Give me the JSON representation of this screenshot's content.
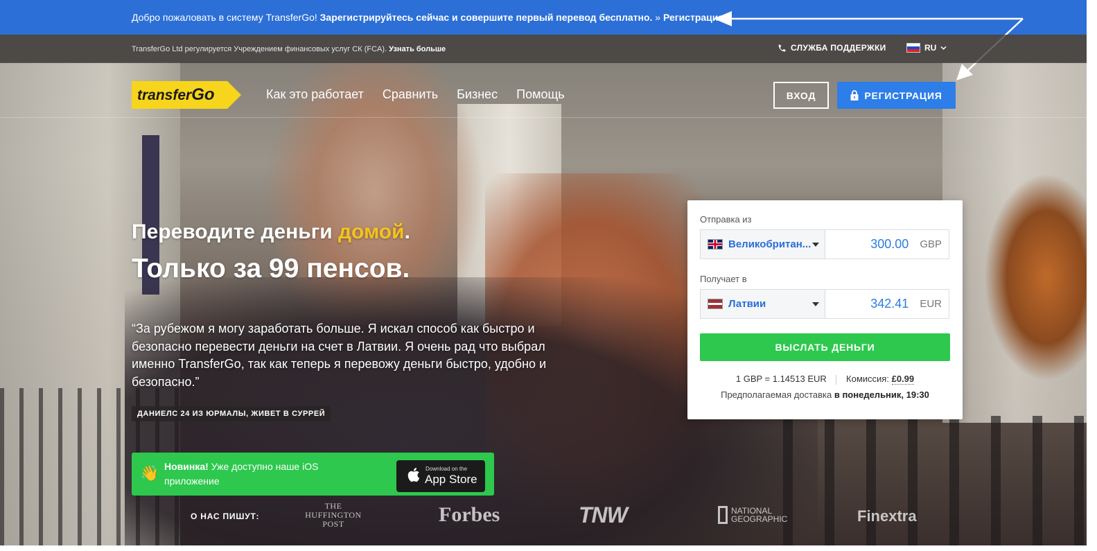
{
  "banner": {
    "welcome": "Добро пожаловать в систему TransferGo!",
    "cta": "Зарегистрируйтесь сейчас и совершите первый перевод бесплатно.",
    "separator": "»",
    "link": "Регистрация",
    "color": "#2c6fd6"
  },
  "subbar": {
    "fca_text": "TransferGo Ltd регулируется Учреждением финансовых услуг СК (FCA).",
    "fca_link": "Узнать больше",
    "support": "СЛУЖБА ПОДДЕРЖКИ",
    "support_icon": "phone-icon",
    "language": "RU",
    "language_flag": "flag-ru-icon"
  },
  "nav": {
    "logo_text_1": "transfer",
    "logo_text_2": "Go",
    "items": [
      "Как это работает",
      "Сравнить",
      "Бизнес",
      "Помощь"
    ],
    "login": "ВХОД",
    "register": "РЕГИСТРАЦИЯ",
    "register_icon": "lock-icon"
  },
  "hero": {
    "headline_start": "Переводите деньги",
    "headline_accent": "домой",
    "headline_end": ".",
    "subheadline": "Только за 99 пенсов.",
    "quote": "“За рубежом я могу заработать больше. Я искал способ как быстро и безопасно перевести деньги на счет в Латвии. Я очень рад что выбрал именно TransferGo, так как теперь я перевожу деньги быстро, удобно и безопасно.”",
    "author": "ДАНИЕЛС 24 ИЗ ЮРМАЛЫ, ЖИВЕТ В СУРРЕЙ",
    "accent_color": "#f6c21c"
  },
  "ios_banner": {
    "bold": "Новинка!",
    "text": "Уже доступно наше iOS приложение",
    "icon": "waving-hand-icon",
    "store_small": "Download on the",
    "store_big": "App Store"
  },
  "press": {
    "label": "О НАС ПИШУТ:",
    "huffington_lines": [
      "THE",
      "HUFFINGTON",
      "POST"
    ],
    "forbes": "Forbes",
    "tnw": "TNW",
    "natgeo_lines": [
      "NATIONAL",
      "GEOGRAPHIC"
    ],
    "finextra": "Finextra"
  },
  "calculator": {
    "from_label": "Отправка из",
    "from_country": "Великобритан...",
    "from_amount": "300.00",
    "from_currency": "GBP",
    "to_label": "Получает в",
    "to_country": "Латвии",
    "to_amount": "342.41",
    "to_currency": "EUR",
    "send_button": "ВЫСЛАТЬ ДЕНЬГИ",
    "rate": "1 GBP = 1.14513 EUR",
    "fee_label": "Комиссия:",
    "fee_value": "£0.99",
    "delivery_label": "Предполагаемая доставка",
    "delivery_value": "в понедельник, 19:30"
  }
}
